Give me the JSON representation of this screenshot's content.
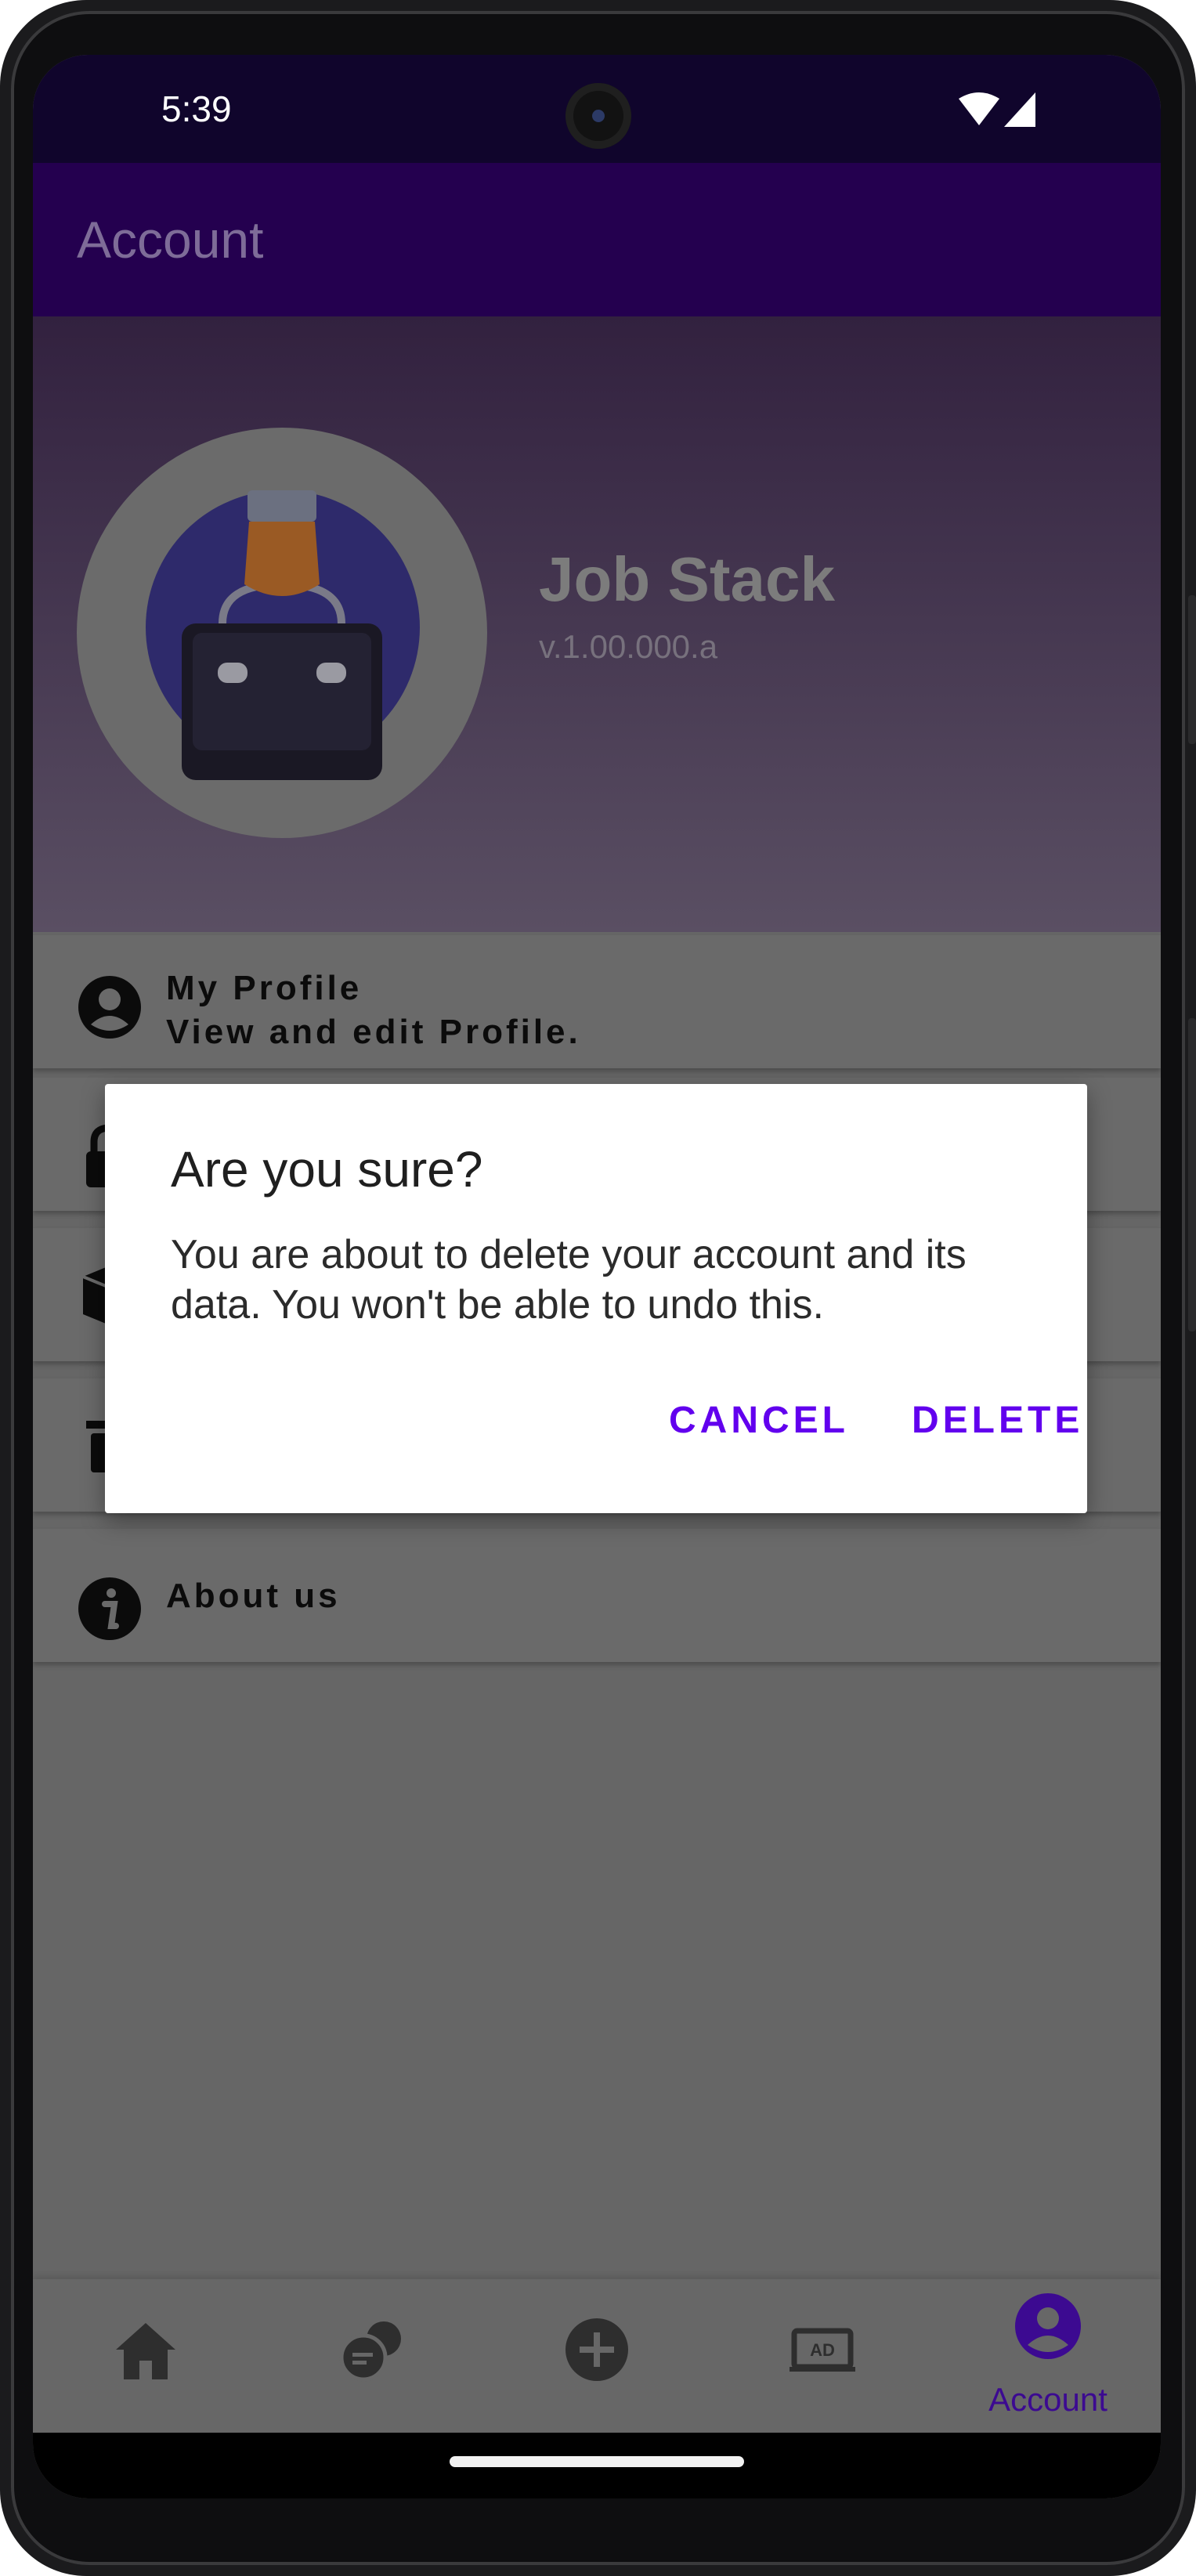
{
  "status_bar": {
    "time": "5:39"
  },
  "app_bar": {
    "title": "Account"
  },
  "header": {
    "app_name": "Job Stack",
    "version": "v.1.00.000.a"
  },
  "menu": [
    {
      "title": "My Profile",
      "subtitle": "View and edit Profile.",
      "icon": "person-circle-icon"
    },
    {
      "title": "",
      "icon": "lock-icon"
    },
    {
      "title": "",
      "icon": "box-icon"
    },
    {
      "title": "",
      "icon": "trash-icon"
    },
    {
      "title": "About us",
      "icon": "info-icon"
    }
  ],
  "dialog": {
    "title": "Are you sure?",
    "message": "You are about to delete your account and its data. You won't be able to undo this.",
    "cancel_label": "CANCEL",
    "delete_label": "DELETE"
  },
  "bottom_nav": {
    "items": [
      {
        "icon": "home-icon",
        "label": ""
      },
      {
        "icon": "chat-icon",
        "label": ""
      },
      {
        "icon": "add-circle-icon",
        "label": ""
      },
      {
        "icon": "ad-icon",
        "label": ""
      },
      {
        "icon": "account-icon",
        "label": "Account",
        "active": true
      }
    ]
  },
  "colors": {
    "accent": "#6200ee",
    "app_bar": "#24004f",
    "status_bar": "#10052c",
    "scrim_surface": "#666666"
  }
}
